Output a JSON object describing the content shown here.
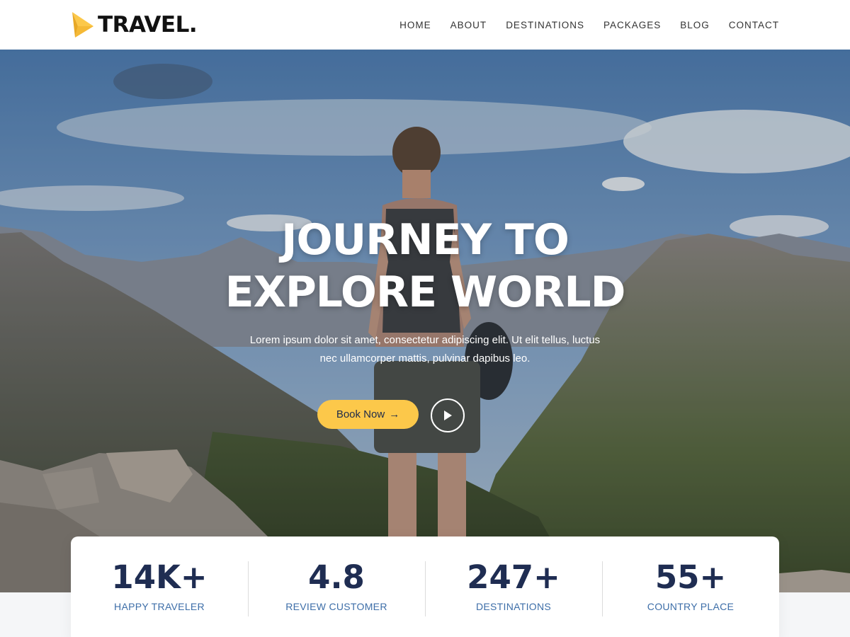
{
  "brand": {
    "name": "TRAVEL.",
    "accent_color": "#fcc84a",
    "icon": "paper-plane-icon"
  },
  "nav": {
    "items": [
      {
        "label": "HOME"
      },
      {
        "label": "ABOUT"
      },
      {
        "label": "DESTINATIONS"
      },
      {
        "label": "PACKAGES"
      },
      {
        "label": "BLOG"
      },
      {
        "label": "CONTACT"
      }
    ]
  },
  "hero": {
    "title_line1": "JOURNEY TO",
    "title_line2": "EXPLORE WORLD",
    "subtitle": "Lorem ipsum dolor sit amet, consectetur adipiscing elit. Ut elit tellus, luctus nec ullamcorper mattis, pulvinar dapibus leo.",
    "book_button": {
      "label": "Book Now",
      "icon": "arrow-right-icon"
    },
    "play_button": {
      "icon": "play-icon"
    }
  },
  "stats": [
    {
      "value": "14K+",
      "label": "HAPPY TRAVELER"
    },
    {
      "value": "4.8",
      "label": "REVIEW CUSTOMER"
    },
    {
      "value": "247+",
      "label": "DESTINATIONS"
    },
    {
      "value": "55+",
      "label": "COUNTRY PLACE"
    }
  ],
  "colors": {
    "heading": "#1f2d52",
    "stat_label": "#3d6ea8"
  }
}
